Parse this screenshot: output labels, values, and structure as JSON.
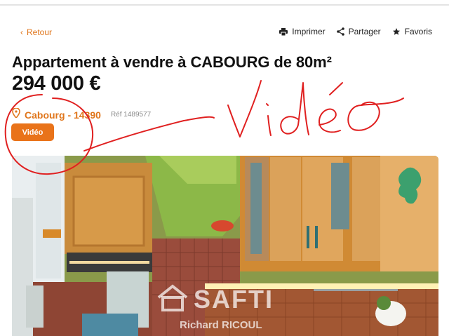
{
  "nav": {
    "back_label": "Retour",
    "actions": {
      "print_label": "Imprimer",
      "share_label": "Partager",
      "favorites_label": "Favoris"
    }
  },
  "listing": {
    "title": "Appartement à vendre à CABOURG de 80m²",
    "price": "294 000 €",
    "location": "Cabourg - 14390",
    "reference": "Réf 1489577",
    "video_button_label": "Vidéo"
  },
  "photo": {
    "watermark_brand": "SAFTI",
    "watermark_agent": "Richard RICOUL"
  },
  "annotation": {
    "handwritten_text": "Vidéo",
    "ink_color": "#e02020"
  },
  "colors": {
    "accent": "#e0761c",
    "button": "#e9731a",
    "title": "#111111"
  },
  "icons": [
    "chevron-left-icon",
    "printer-icon",
    "share-icon",
    "star-icon",
    "location-pin-icon",
    "safti-house-logo-icon"
  ]
}
